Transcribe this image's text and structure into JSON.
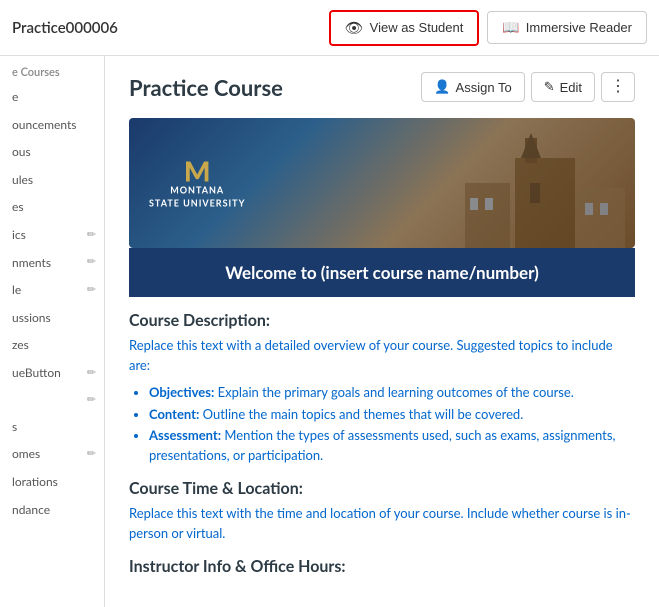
{
  "topbar": {
    "title": "Practice000006",
    "view_student_label": "View as Student",
    "immersive_reader_label": "Immersive Reader"
  },
  "sidebar": {
    "section_label": "e Courses",
    "items": [
      {
        "label": "e",
        "has_edit": false
      },
      {
        "label": "ouncements",
        "has_edit": false
      },
      {
        "label": "ous",
        "has_edit": false
      },
      {
        "label": "ules",
        "has_edit": false
      },
      {
        "label": "es",
        "has_edit": false
      },
      {
        "label": "ics",
        "has_edit": true
      },
      {
        "label": "nments",
        "has_edit": true
      },
      {
        "label": "le",
        "has_edit": true
      },
      {
        "label": "ussions",
        "has_edit": false
      },
      {
        "label": "zes",
        "has_edit": false
      },
      {
        "label": "ueButton",
        "has_edit": true
      },
      {
        "label": "",
        "has_edit": true
      },
      {
        "label": "s",
        "has_edit": false
      },
      {
        "label": "omes",
        "has_edit": true
      },
      {
        "label": "lorations",
        "has_edit": false
      },
      {
        "label": "ndance",
        "has_edit": false
      }
    ]
  },
  "main": {
    "course_title": "Practice Course",
    "assign_label": "Assign To",
    "edit_label": "Edit",
    "welcome_text": "Welcome to (insert course name/number)",
    "sections": [
      {
        "heading": "Course Description:",
        "intro": "Replace this text with a detailed overview of your course. Suggested topics to include are:",
        "list": [
          {
            "label": "Objectives:",
            "text": " Explain the primary goals and learning outcomes of the course."
          },
          {
            "label": "Content:",
            "text": " Outline the main topics and themes that will be covered."
          },
          {
            "label": "Assessment:",
            "text": " Mention the types of assessments used, such as exams, assignments, presentations, or participation."
          }
        ]
      },
      {
        "heading": "Course Time & Location:",
        "intro": "Replace this text with the time and location of your course. Include whether course is in-person or virtual.",
        "list": []
      },
      {
        "heading": "Instructor Info & Office Hours:",
        "intro": "",
        "list": []
      }
    ]
  }
}
